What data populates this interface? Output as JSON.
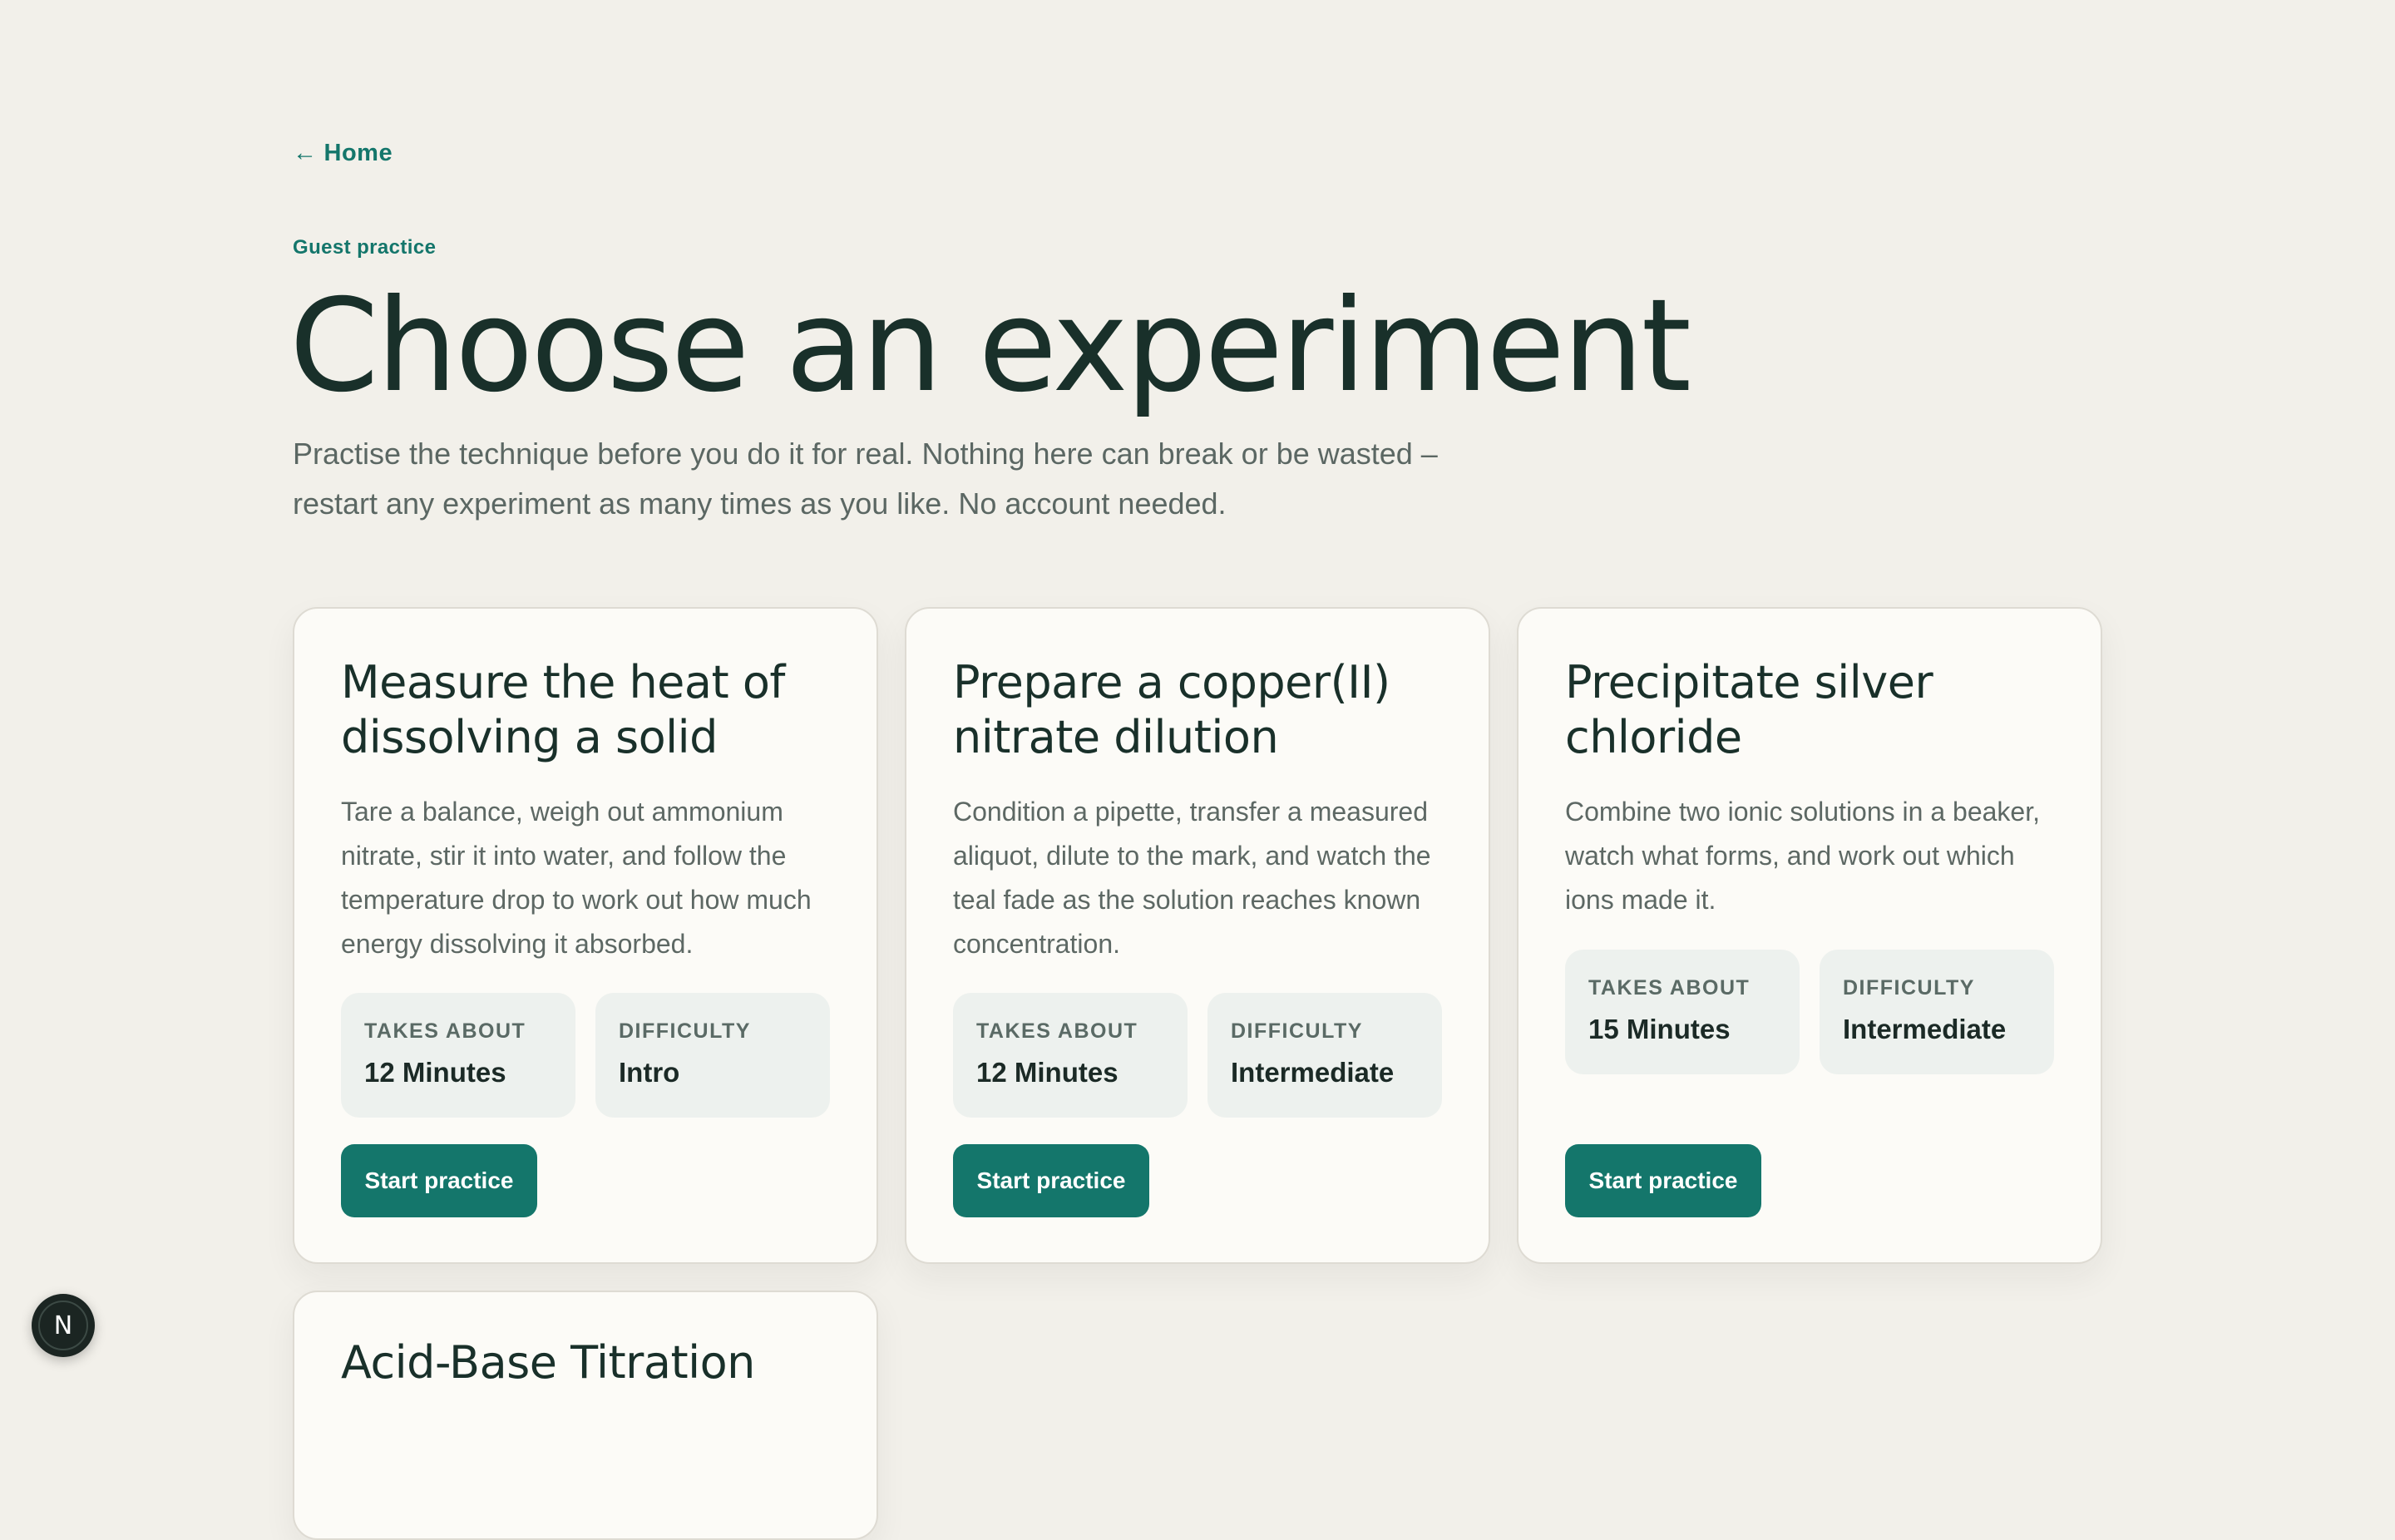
{
  "nav": {
    "home_arrow": "←",
    "home_label": "Home"
  },
  "header": {
    "eyebrow": "Guest practice",
    "title": "Choose an experiment",
    "lede": "Practise the technique before you do it for real. Nothing here can break or be wasted – restart any experiment as many times as you like. No account needed."
  },
  "experiments": [
    {
      "title": "Measure the heat of dissolving a solid",
      "description": "Tare a balance, weigh out ammonium nitrate, stir it into water, and follow the temperature drop to work out how much energy dissolving it absorbed.",
      "time_label": "Takes about",
      "time_value": "12 Minutes",
      "difficulty_label": "Difficulty",
      "difficulty_value": "Intro",
      "button_label": "Start practice"
    },
    {
      "title": "Prepare a copper(II) nitrate dilution",
      "description": "Condition a pipette, transfer a measured aliquot, dilute to the mark, and watch the teal fade as the solution reaches known concentration.",
      "time_label": "Takes about",
      "time_value": "12 Minutes",
      "difficulty_label": "Difficulty",
      "difficulty_value": "Intermediate",
      "button_label": "Start practice"
    },
    {
      "title": "Precipitate silver chloride",
      "description": "Combine two ionic solutions in a beaker, watch what forms, and work out which ions made it.",
      "time_label": "Takes about",
      "time_value": "15 Minutes",
      "difficulty_label": "Difficulty",
      "difficulty_value": "Intermediate",
      "button_label": "Start practice"
    },
    {
      "title": "Acid-Base Titration"
    }
  ],
  "dev_badge": {
    "letter": "N"
  },
  "colors": {
    "background": "#f2f0ea",
    "accent": "#14766b",
    "card": "#fcfbf7",
    "stat_tile": "#edf1ee",
    "heading": "#19302a"
  }
}
